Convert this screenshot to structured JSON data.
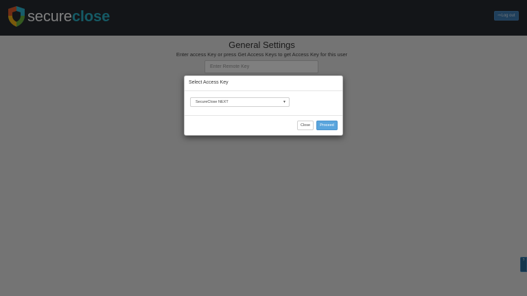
{
  "header": {
    "logo_text_secure": "secure",
    "logo_text_close": "close",
    "logout_label": "Log out",
    "logout_icon": "sign-out-icon"
  },
  "main": {
    "title": "General Settings",
    "subtitle": "Enter access Key or press Get Access Keys to get Access Key for this user",
    "remote_key_placeholder": "Enter Remote Key"
  },
  "modal": {
    "title": "Select Access Key",
    "selected_key": "SecureClose NEXT",
    "close_label": "Close",
    "proceed_label": "Proceed"
  },
  "side_tab": {
    "icon": "help-icon"
  },
  "colors": {
    "navbar": "#262b31",
    "brand_teal": "#2bb3c8",
    "primary_button": "#5aa5dd",
    "logout_button": "#3f7fb6"
  }
}
